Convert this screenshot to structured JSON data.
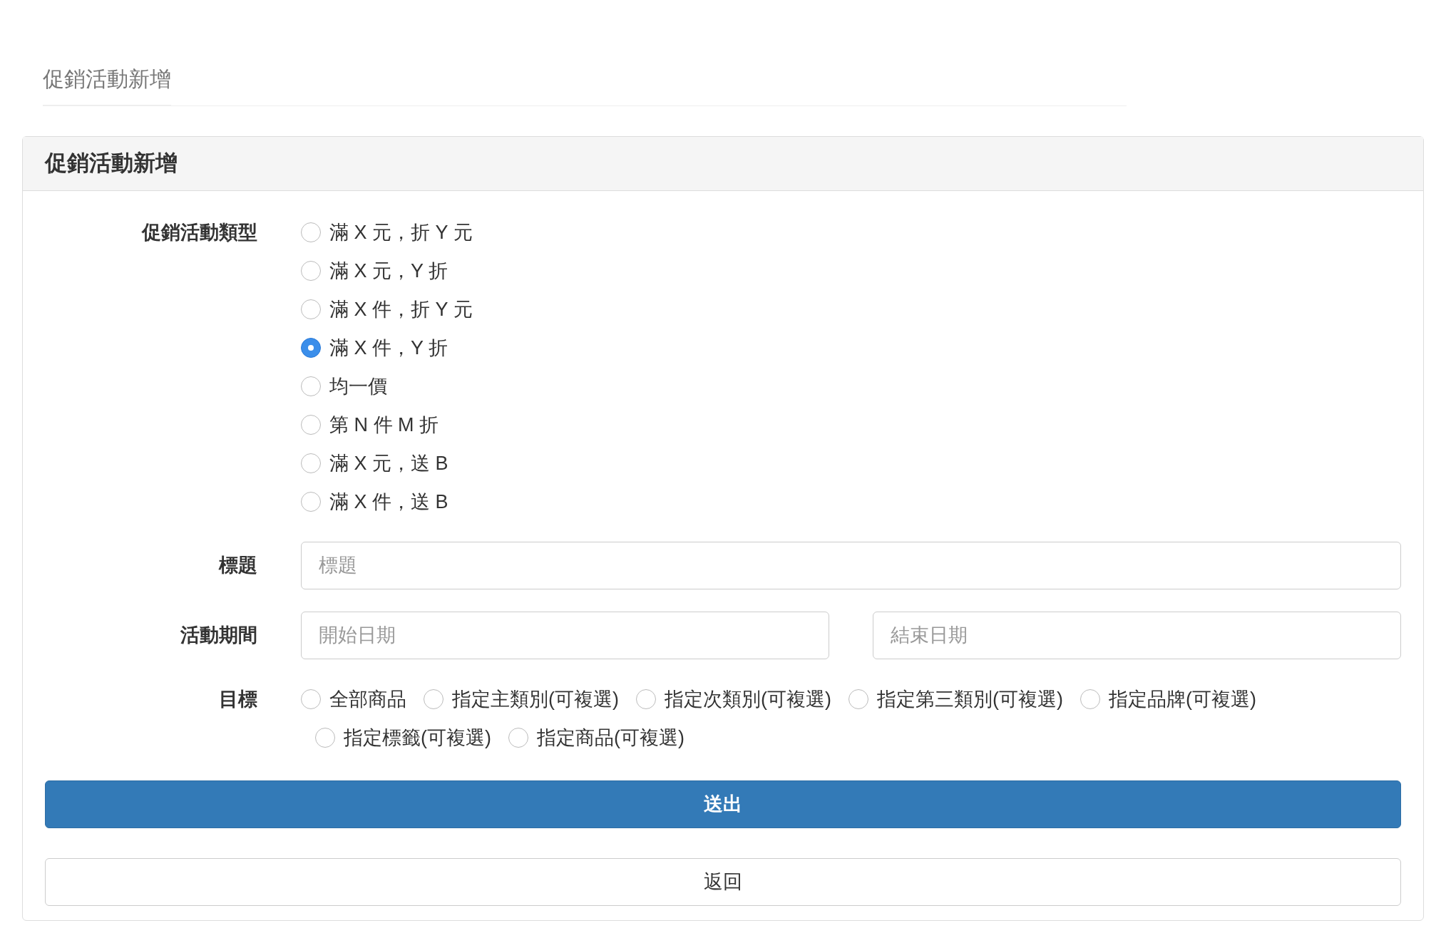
{
  "page_title": "促銷活動新增",
  "panel": {
    "title": "促銷活動新增"
  },
  "promotion_type": {
    "label": "促銷活動類型",
    "options": [
      {
        "label": "滿 X 元，折 Y 元",
        "selected": false
      },
      {
        "label": "滿 X 元，Y 折",
        "selected": false
      },
      {
        "label": "滿 X 件，折 Y 元",
        "selected": false
      },
      {
        "label": "滿 X 件，Y 折",
        "selected": true
      },
      {
        "label": "均一價",
        "selected": false
      },
      {
        "label": "第 N 件 M 折",
        "selected": false
      },
      {
        "label": "滿 X 元，送 B",
        "selected": false
      },
      {
        "label": "滿 X 件，送 B",
        "selected": false
      }
    ]
  },
  "title_field": {
    "label": "標題",
    "placeholder": "標題"
  },
  "period": {
    "label": "活動期間",
    "start": {
      "placeholder": "開始日期"
    },
    "end": {
      "placeholder": "結束日期"
    }
  },
  "target": {
    "label": "目標",
    "options": [
      {
        "label": "全部商品",
        "selected": false
      },
      {
        "label": "指定主類別(可複選)",
        "selected": false
      },
      {
        "label": "指定次類別(可複選)",
        "selected": false
      },
      {
        "label": "指定第三類別(可複選)",
        "selected": false
      },
      {
        "label": "指定品牌(可複選)",
        "selected": false
      },
      {
        "label": "指定標籤(可複選)",
        "selected": false
      },
      {
        "label": "指定商品(可複選)",
        "selected": false
      }
    ]
  },
  "buttons": [
    {
      "label": "送出",
      "kind": "primary"
    },
    {
      "label": "返回",
      "kind": "default"
    }
  ]
}
